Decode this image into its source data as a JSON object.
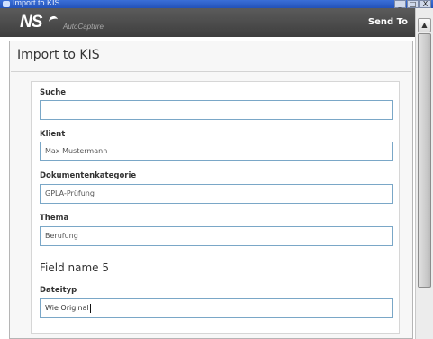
{
  "window": {
    "title": "Import to KIS",
    "controls": [
      "_",
      "□",
      "X"
    ]
  },
  "header": {
    "logo_text": "NS",
    "product_text": "AutoCapture",
    "send_to_label": "Send To"
  },
  "panel": {
    "title": "Import to KIS"
  },
  "form": {
    "suche": {
      "label": "Suche",
      "value": ""
    },
    "klient": {
      "label": "Klient",
      "value": "Max Mustermann"
    },
    "dokumentenkategorie": {
      "label": "Dokumentenkategorie",
      "value": "GPLA-Prüfung"
    },
    "thema": {
      "label": "Thema",
      "value": "Berufung"
    },
    "field5_heading": "Field name 5",
    "dateityp": {
      "label": "Dateityp",
      "value": "Wie Original"
    }
  },
  "scrollbar": {
    "up_arrow": "▲"
  }
}
